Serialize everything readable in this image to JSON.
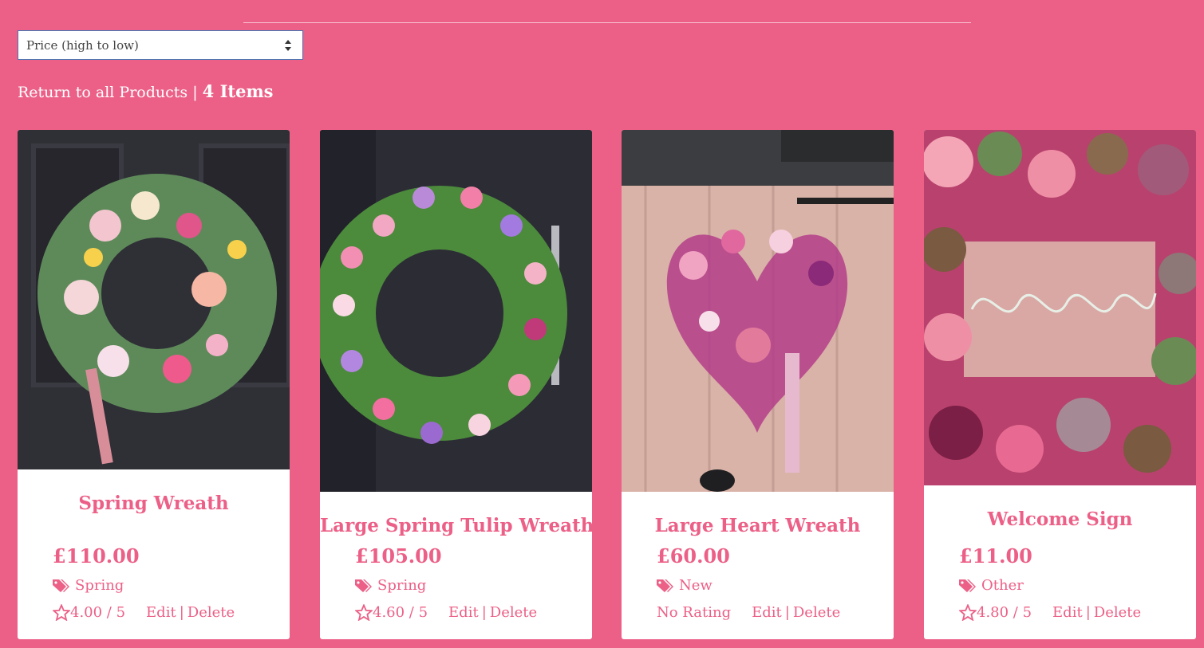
{
  "sort": {
    "selected": "Price (high to low)"
  },
  "summary": {
    "link": "Return to all Products",
    "separator": " | ",
    "count": "4 Items"
  },
  "products": [
    {
      "name": "Spring Wreath",
      "price": "£110.00",
      "category": "Spring",
      "rating": "4.00 / 5",
      "edit": "Edit",
      "delete": "Delete",
      "divider": "|"
    },
    {
      "name": "Large Spring Tulip Wreath",
      "price": "£105.00",
      "category": "Spring",
      "rating": "4.60 / 5",
      "edit": "Edit",
      "delete": "Delete",
      "divider": "|"
    },
    {
      "name": "Large Heart Wreath",
      "price": "£60.00",
      "category": "New",
      "rating": "No Rating",
      "edit": "Edit",
      "delete": "Delete",
      "divider": "|"
    },
    {
      "name": "Welcome Sign",
      "price": "£11.00",
      "category": "Other",
      "rating": "4.80 / 5",
      "edit": "Edit",
      "delete": "Delete",
      "divider": "|"
    }
  ],
  "colors": {
    "background": "#ec6087",
    "accent": "#ec6087",
    "card": "#ffffff"
  },
  "icons": {
    "category": "tags-icon",
    "rating": "star-outline-icon",
    "sort": "sort-arrows-icon"
  }
}
